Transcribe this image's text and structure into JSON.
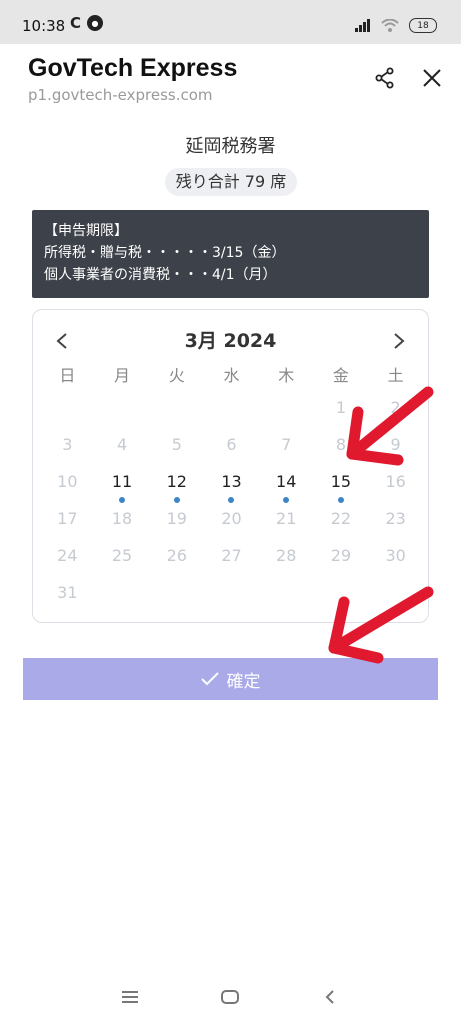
{
  "status": {
    "time": "10:38",
    "battery": "18"
  },
  "header": {
    "title": "GovTech Express",
    "url": "p1.govtech-express.com"
  },
  "office": {
    "name": "延岡税務署",
    "seats": "残り合計 79 席"
  },
  "deadline": {
    "heading": "【申告期限】",
    "line1": "所得税・贈与税・・・・・3/15（金）",
    "line2": "個人事業者の消費税・・・4/1（月）"
  },
  "calendar": {
    "month": "3月 2024",
    "weekdays": [
      "日",
      "月",
      "火",
      "水",
      "木",
      "金",
      "土"
    ],
    "leading_blanks": 5,
    "days": [
      {
        "d": "1",
        "avail": false
      },
      {
        "d": "2",
        "avail": false
      },
      {
        "d": "3",
        "avail": false
      },
      {
        "d": "4",
        "avail": false
      },
      {
        "d": "5",
        "avail": false
      },
      {
        "d": "6",
        "avail": false
      },
      {
        "d": "7",
        "avail": false
      },
      {
        "d": "8",
        "avail": false
      },
      {
        "d": "9",
        "avail": false
      },
      {
        "d": "10",
        "avail": false
      },
      {
        "d": "11",
        "avail": true
      },
      {
        "d": "12",
        "avail": true
      },
      {
        "d": "13",
        "avail": true
      },
      {
        "d": "14",
        "avail": true
      },
      {
        "d": "15",
        "avail": true
      },
      {
        "d": "16",
        "avail": false
      },
      {
        "d": "17",
        "avail": false
      },
      {
        "d": "18",
        "avail": false
      },
      {
        "d": "19",
        "avail": false
      },
      {
        "d": "20",
        "avail": false
      },
      {
        "d": "21",
        "avail": false
      },
      {
        "d": "22",
        "avail": false
      },
      {
        "d": "23",
        "avail": false
      },
      {
        "d": "24",
        "avail": false
      },
      {
        "d": "25",
        "avail": false
      },
      {
        "d": "26",
        "avail": false
      },
      {
        "d": "27",
        "avail": false
      },
      {
        "d": "28",
        "avail": false
      },
      {
        "d": "29",
        "avail": false
      },
      {
        "d": "30",
        "avail": false
      },
      {
        "d": "31",
        "avail": false
      }
    ]
  },
  "confirm": {
    "label": "確定"
  },
  "colors": {
    "accent": "#aaaae8",
    "dot": "#3a86c8",
    "arrow": "#e0192e",
    "deadline_bg": "#3d4149"
  }
}
